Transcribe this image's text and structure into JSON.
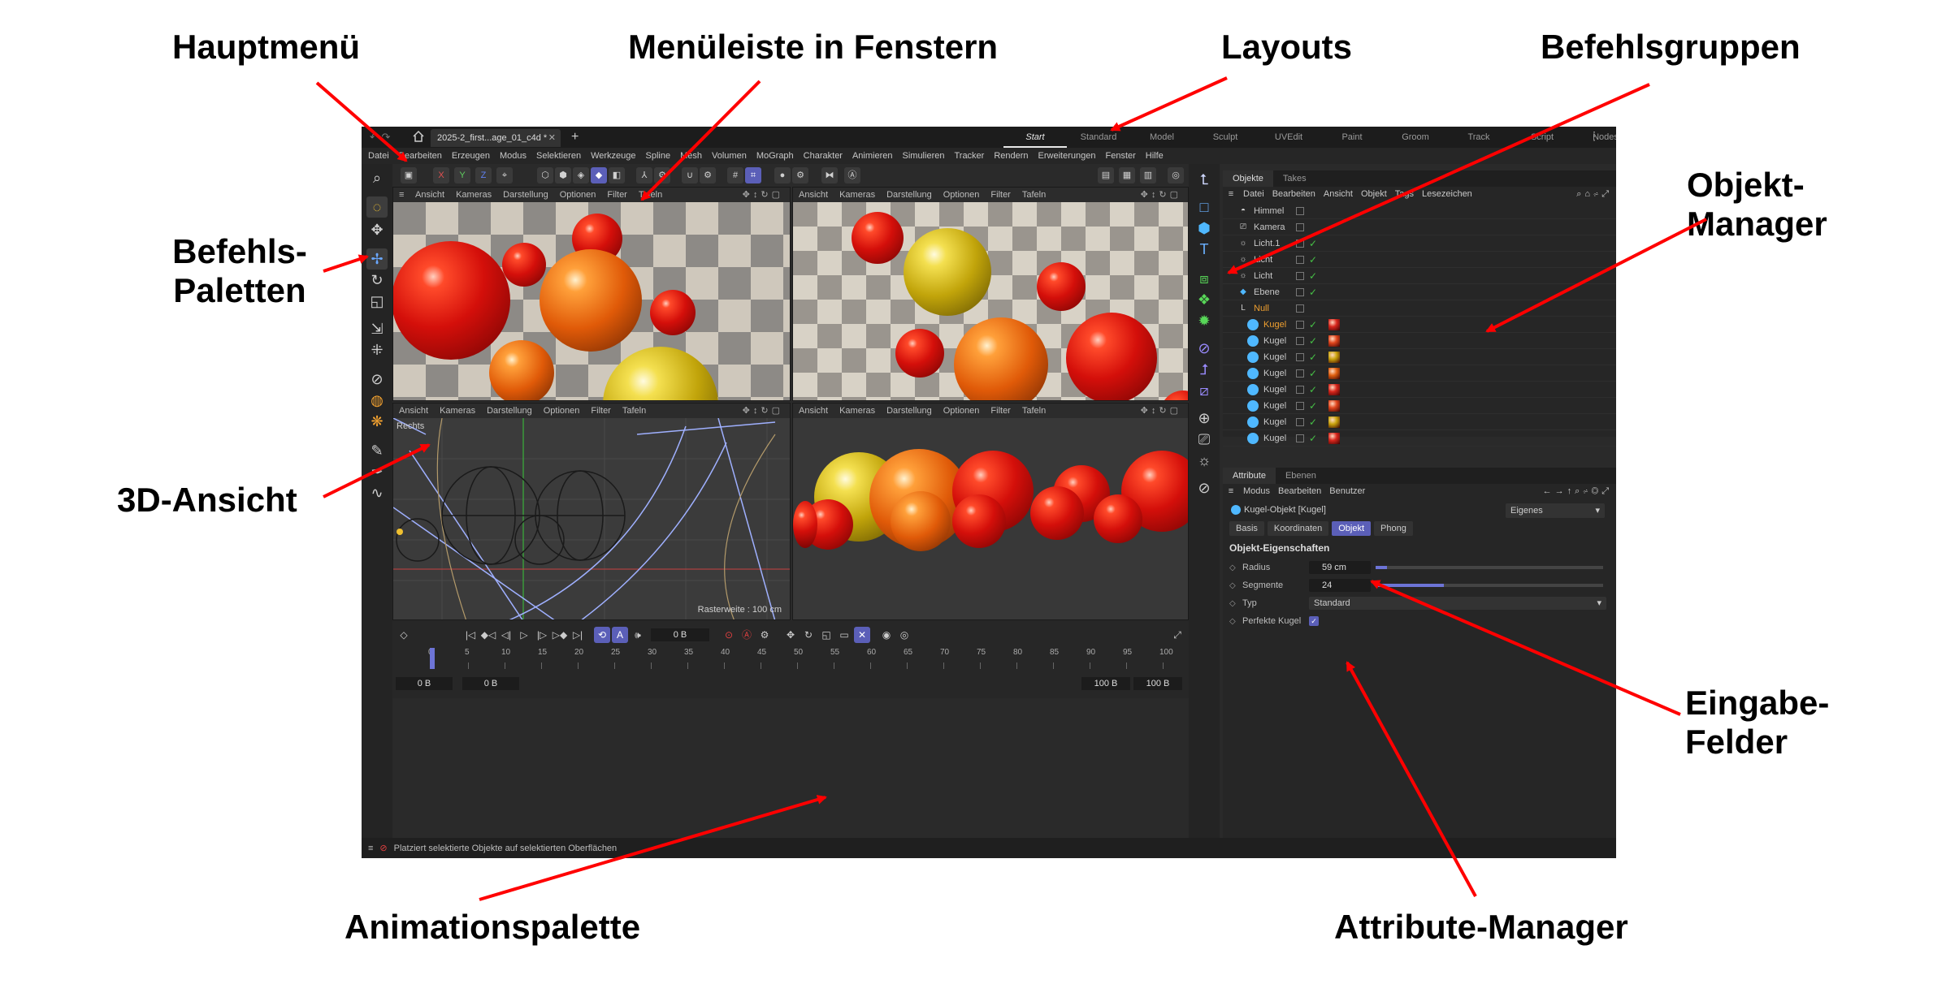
{
  "annotations": {
    "hauptmenue": "Hauptmenü",
    "menueleiste": "Menüleiste in Fenstern",
    "layouts": "Layouts",
    "befehlsgruppen": "Befehlsgruppen",
    "befehlspaletten_1": "Befehls-",
    "befehlspaletten_2": "Paletten",
    "objektmanager_1": "Objekt-",
    "objektmanager_2": "Manager",
    "ansicht3d": "3D-Ansicht",
    "eingabefelder_1": "Eingabe-",
    "eingabefelder_2": "Felder",
    "animationspalette": "Animationspalette",
    "attributemanager": "Attribute-Manager"
  },
  "app": {
    "file_tab": "2025-2_first...age_01_c4d *",
    "layouts": [
      "Start",
      "Standard",
      "Model",
      "Sculpt",
      "UVEdit",
      "Paint",
      "Groom",
      "Track",
      "Script",
      "Nodes"
    ],
    "main_menu": [
      "Datei",
      "Bearbeiten",
      "Erzeugen",
      "Modus",
      "Selektieren",
      "Werkzeuge",
      "Spline",
      "Mesh",
      "Volumen",
      "MoGraph",
      "Charakter",
      "Animieren",
      "Simulieren",
      "Tracker",
      "Rendern",
      "Erweiterungen",
      "Fenster",
      "Hilfe"
    ],
    "toolbar_axes": [
      "X",
      "Y",
      "Z"
    ],
    "viewport_menu": [
      "Ansicht",
      "Kameras",
      "Darstellung",
      "Optionen",
      "Filter",
      "Tafeln"
    ],
    "viewport_right_label": "Rechts",
    "raster": "Rasterweite : 100 cm",
    "object_manager": {
      "tabs": [
        "Objekte",
        "Takes"
      ],
      "menu": [
        "Datei",
        "Bearbeiten",
        "Ansicht",
        "Objekt",
        "Tags",
        "Lesezeichen"
      ],
      "objects": [
        "Himmel",
        "Kamera",
        "Licht.1",
        "Licht",
        "Licht",
        "Ebene",
        "Null",
        "Kugel",
        "Kugel",
        "Kugel",
        "Kugel",
        "Kugel",
        "Kugel",
        "Kugel",
        "Kugel"
      ]
    },
    "attribute_manager": {
      "tabs": [
        "Attribute",
        "Ebenen"
      ],
      "menu": [
        "Modus",
        "Bearbeiten",
        "Benutzer"
      ],
      "title": "Kugel-Objekt [Kugel]",
      "dropdown": "Eigenes",
      "subtabs": [
        "Basis",
        "Koordinaten",
        "Objekt",
        "Phong"
      ],
      "section": "Objekt-Eigenschaften",
      "radius_label": "Radius",
      "radius_value": "59 cm",
      "radius_fraction": 0.05,
      "segments_label": "Segmente",
      "segments_value": "24",
      "segments_fraction": 0.3,
      "type_label": "Typ",
      "type_value": "Standard",
      "perfect_label": "Perfekte Kugel"
    },
    "timeline": {
      "current_frame": "0 B",
      "ticks": [
        "0",
        "5",
        "10",
        "15",
        "20",
        "25",
        "30",
        "35",
        "40",
        "45",
        "50",
        "55",
        "60",
        "65",
        "70",
        "75",
        "80",
        "85",
        "90",
        "95",
        "100"
      ],
      "start": "0 B",
      "start2": "0 B",
      "end": "100 B",
      "end2": "100 B"
    },
    "status": "Platziert selektierte Objekte auf selektierten Oberflächen"
  },
  "colors": {
    "accent": "#5b5fb8",
    "arrow": "#ff0000",
    "check": "#46c046",
    "highlight": "#f0a030"
  }
}
